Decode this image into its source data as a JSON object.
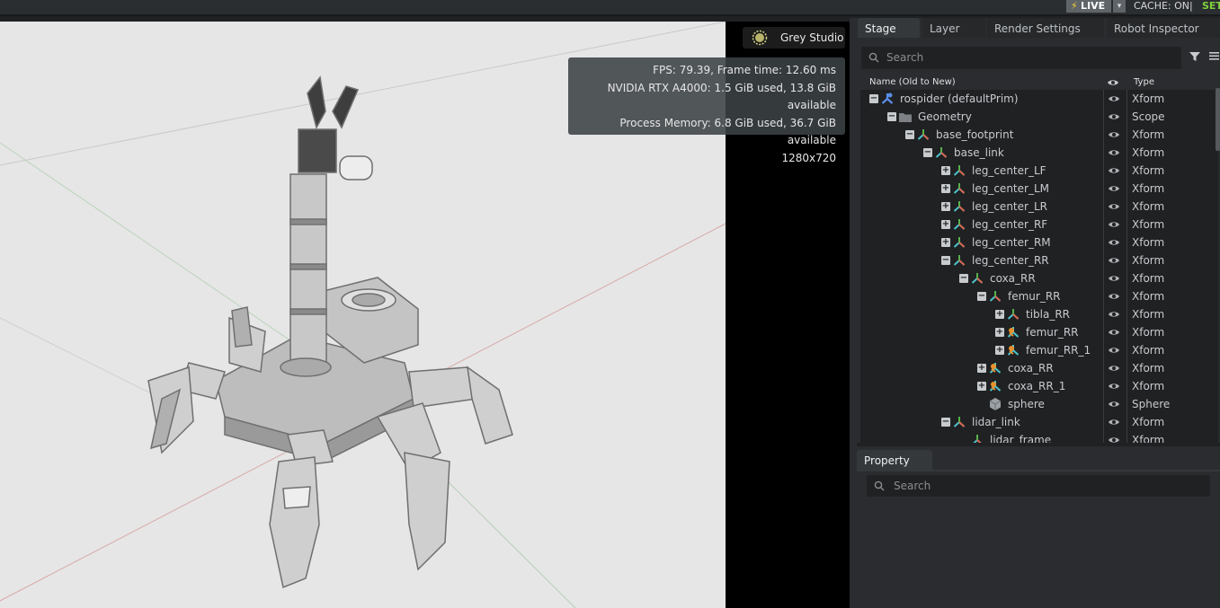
{
  "topbar": {
    "live_label": "LIVE",
    "cache_label": "CACHE: ON|",
    "set_label": "SET"
  },
  "viewport": {
    "lighting_label": "Grey Studio",
    "stats": {
      "fps": "FPS: 79.39, Frame time: 12.60 ms",
      "gpu": "NVIDIA RTX A4000: 1.5 GiB used, 13.8 GiB available",
      "memory": "Process Memory: 6.8 GiB used, 36.7 GiB available",
      "resolution": "1280x720"
    }
  },
  "stage_panel": {
    "tabs": [
      "Stage",
      "Layer",
      "Render Settings",
      "Robot Inspector"
    ],
    "search_placeholder": "Search",
    "columns": {
      "name": "Name (Old to New)",
      "type": "Type"
    },
    "rows": [
      {
        "name": "rospider (defaultPrim)",
        "type": "Xform"
      },
      {
        "name": "Geometry",
        "type": "Scope"
      },
      {
        "name": "base_footprint",
        "type": "Xform"
      },
      {
        "name": "base_link",
        "type": "Xform"
      },
      {
        "name": "leg_center_LF",
        "type": "Xform"
      },
      {
        "name": "leg_center_LM",
        "type": "Xform"
      },
      {
        "name": "leg_center_LR",
        "type": "Xform"
      },
      {
        "name": "leg_center_RF",
        "type": "Xform"
      },
      {
        "name": "leg_center_RM",
        "type": "Xform"
      },
      {
        "name": "leg_center_RR",
        "type": "Xform"
      },
      {
        "name": "coxa_RR",
        "type": "Xform"
      },
      {
        "name": "femur_RR",
        "type": "Xform"
      },
      {
        "name": "tibla_RR",
        "type": "Xform"
      },
      {
        "name": "femur_RR",
        "type": "Xform"
      },
      {
        "name": "femur_RR_1",
        "type": "Xform"
      },
      {
        "name": "coxa_RR",
        "type": "Xform"
      },
      {
        "name": "coxa_RR_1",
        "type": "Xform"
      },
      {
        "name": "sphere",
        "type": "Sphere"
      },
      {
        "name": "lidar_link",
        "type": "Xform"
      },
      {
        "name": "lidar_frame",
        "type": "Xform"
      }
    ]
  },
  "property_panel": {
    "tab_label": "Property",
    "search_placeholder": "Search"
  },
  "colors": {
    "accent_live": "#f4d433",
    "set_green": "#7fd13b",
    "panel": "#2a2c2f",
    "tree_bg": "#1f2123",
    "viewport_bg": "#e6e6e6"
  }
}
